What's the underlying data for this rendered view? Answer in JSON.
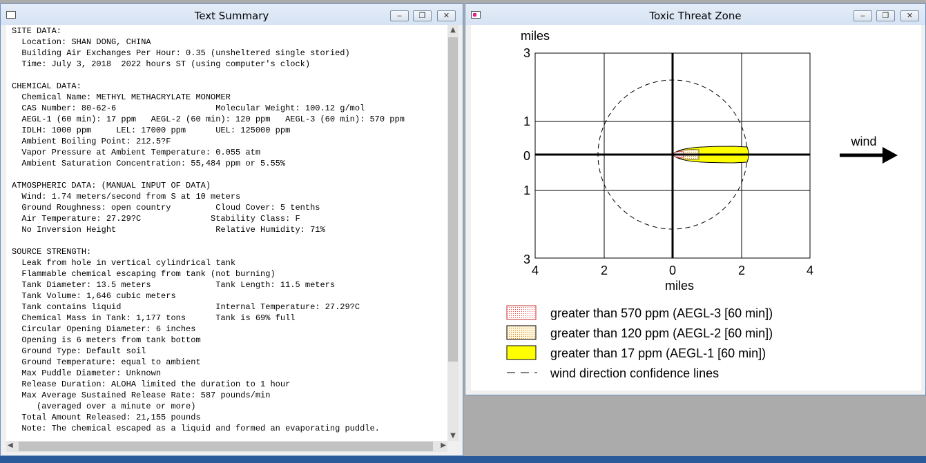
{
  "text_window": {
    "title": "Text Summary",
    "lines": [
      "SITE DATA:",
      "  Location: SHAN DONG, CHINA",
      "  Building Air Exchanges Per Hour: 0.35 (unsheltered single storied)",
      "  Time: July 3, 2018  2022 hours ST (using computer's clock)",
      "",
      "CHEMICAL DATA:",
      "  Chemical Name: METHYL METHACRYLATE MONOMER",
      "  CAS Number: 80-62-6                    Molecular Weight: 100.12 g/mol",
      "  AEGL-1 (60 min): 17 ppm   AEGL-2 (60 min): 120 ppm   AEGL-3 (60 min): 570 ppm",
      "  IDLH: 1000 ppm     LEL: 17000 ppm      UEL: 125000 ppm",
      "  Ambient Boiling Point: 212.5?F",
      "  Vapor Pressure at Ambient Temperature: 0.055 atm",
      "  Ambient Saturation Concentration: 55,484 ppm or 5.55%",
      "",
      "ATMOSPHERIC DATA: (MANUAL INPUT OF DATA)",
      "  Wind: 1.74 meters/second from S at 10 meters",
      "  Ground Roughness: open country         Cloud Cover: 5 tenths",
      "  Air Temperature: 27.29?C              Stability Class: F",
      "  No Inversion Height                    Relative Humidity: 71%",
      "",
      "SOURCE STRENGTH:",
      "  Leak from hole in vertical cylindrical tank",
      "  Flammable chemical escaping from tank (not burning)",
      "  Tank Diameter: 13.5 meters             Tank Length: 11.5 meters",
      "  Tank Volume: 1,646 cubic meters",
      "  Tank contains liquid                   Internal Temperature: 27.29?C",
      "  Chemical Mass in Tank: 1,177 tons      Tank is 69% full",
      "  Circular Opening Diameter: 6 inches",
      "  Opening is 6 meters from tank bottom",
      "  Ground Type: Default soil",
      "  Ground Temperature: equal to ambient",
      "  Max Puddle Diameter: Unknown",
      "  Release Duration: ALOHA limited the duration to 1 hour",
      "  Max Average Sustained Release Rate: 587 pounds/min",
      "     (averaged over a minute or more)",
      "  Total Amount Released: 21,155 pounds",
      "  Note: The chemical escaped as a liquid and formed an evaporating puddle."
    ]
  },
  "zone_window": {
    "title": "Toxic Threat Zone",
    "y_axis_label": "miles",
    "x_axis_label": "miles",
    "wind_label": "wind",
    "y_ticks": [
      "3",
      "1",
      "0",
      "1",
      "3"
    ],
    "x_ticks": [
      "4",
      "2",
      "0",
      "2",
      "4"
    ],
    "legend": [
      {
        "label": "greater than 570 ppm (AEGL-3 [60 min])",
        "color": "#ff4040",
        "pattern": "red-dots"
      },
      {
        "label": "greater than 120 ppm (AEGL-2 [60 min])",
        "color": "#e0a050",
        "pattern": "orange-dots"
      },
      {
        "label": "greater than 17 ppm (AEGL-1 [60 min])",
        "color": "#ffff00",
        "pattern": "solid-yellow"
      },
      {
        "label": "wind direction confidence lines",
        "color": "#000000",
        "pattern": "dashed-line"
      }
    ]
  },
  "window_buttons": {
    "minimize": "‒",
    "restore": "❐",
    "close": "✕"
  },
  "scroll_arrows": {
    "up": "▲",
    "down": "▼",
    "left": "◀",
    "right": "▶"
  },
  "colors": {
    "titlebar": "#d6e3f3",
    "border": "#6b90c0",
    "aegl3": "#ff4040",
    "aegl2": "#e0a050",
    "aegl1": "#ffff00"
  }
}
